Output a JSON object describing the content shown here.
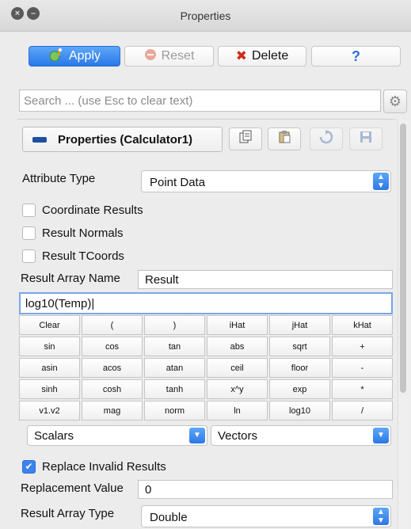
{
  "window": {
    "title": "Properties"
  },
  "toolbar": {
    "apply": "Apply",
    "reset": "Reset",
    "delete": "Delete",
    "help": "?"
  },
  "search": {
    "placeholder": "Search ... (use Esc to clear text)"
  },
  "panel": {
    "title": "Properties (Calculator1)"
  },
  "attribute_type": {
    "label": "Attribute Type",
    "value": "Point Data"
  },
  "checks": {
    "coordinate_results": {
      "label": "Coordinate Results",
      "checked": false
    },
    "result_normals": {
      "label": "Result Normals",
      "checked": false
    },
    "result_tcoords": {
      "label": "Result TCoords",
      "checked": false
    }
  },
  "result_array_name": {
    "label": "Result Array Name",
    "value": "Result"
  },
  "expression": {
    "value": "log10(Temp)"
  },
  "calculator_keys": [
    [
      "Clear",
      "(",
      ")",
      "iHat",
      "jHat",
      "kHat"
    ],
    [
      "sin",
      "cos",
      "tan",
      "abs",
      "sqrt",
      "+"
    ],
    [
      "asin",
      "acos",
      "atan",
      "ceil",
      "floor",
      "-"
    ],
    [
      "sinh",
      "cosh",
      "tanh",
      "x^y",
      "exp",
      "*"
    ],
    [
      "v1.v2",
      "mag",
      "norm",
      "ln",
      "log10",
      "/"
    ]
  ],
  "scalars": {
    "value": "Scalars"
  },
  "vectors": {
    "value": "Vectors"
  },
  "replace_invalid": {
    "label": "Replace Invalid Results",
    "checked": true
  },
  "replacement_value": {
    "label": "Replacement Value",
    "value": "0"
  },
  "result_array_type": {
    "label": "Result Array Type",
    "value": "Double"
  },
  "colors": {
    "accent": "#2f7df0",
    "text": "#111111",
    "background": "#ececec"
  }
}
